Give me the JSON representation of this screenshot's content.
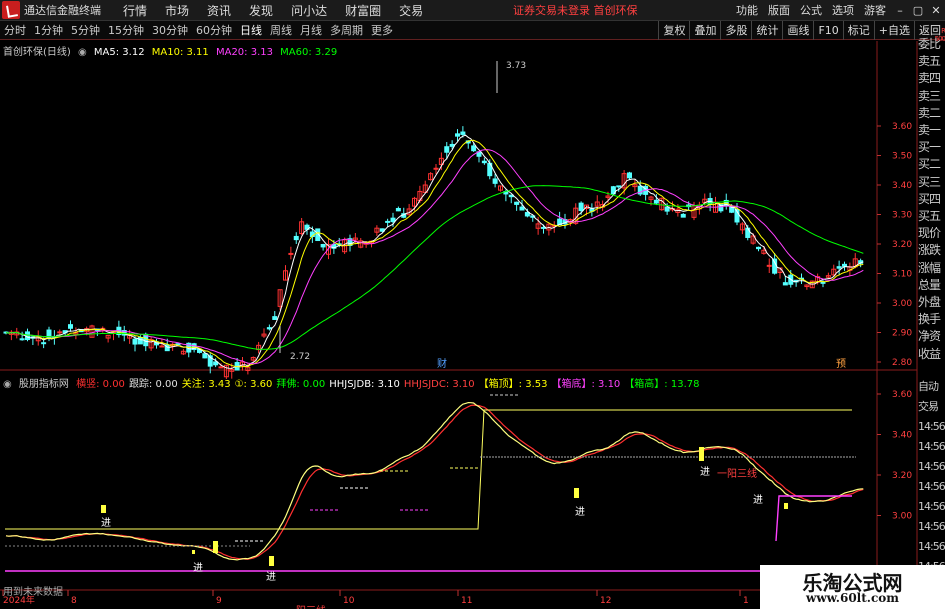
{
  "app": {
    "name": "通达信金融终端",
    "notice": "证券交易未登录  首创环保"
  },
  "menu": [
    "行情",
    "市场",
    "资讯",
    "发现",
    "问小达",
    "财富圈",
    "交易"
  ],
  "menu_right": [
    "功能",
    "版面",
    "公式",
    "选项",
    "游客"
  ],
  "window_controls": [
    "–",
    "▢",
    "✕"
  ],
  "periods": [
    "分时",
    "1分钟",
    "5分钟",
    "15分钟",
    "30分钟",
    "60分钟",
    "日线",
    "周线",
    "月线",
    "多周期",
    "更多"
  ],
  "active_period": "日线",
  "tools": [
    "复权",
    "叠加",
    "多股",
    "统计",
    "画线",
    "F10",
    "标记",
    "+自选",
    "返回"
  ],
  "corner": {
    "r": "R",
    "num": "500"
  },
  "main_legend": {
    "title": "首创环保(日线)",
    "ma5": "MA5: 3.12",
    "ma10": "MA10: 3.11",
    "ma20": "MA20: 3.13",
    "ma60": "MA60: 3.29"
  },
  "main_axis": [
    "3.60",
    "3.50",
    "3.40",
    "3.30",
    "3.20",
    "3.10",
    "3.00",
    "2.90",
    "2.80"
  ],
  "annotations": {
    "high": "3.73",
    "low": "2.72",
    "cai": "财",
    "yu": "预"
  },
  "sub_legend": {
    "title": "股朋指标网",
    "items": [
      {
        "label": "横竖: 0.00",
        "color": "#ff3030"
      },
      {
        "label": "跟踪: 0.00",
        "color": "#e0e0e0"
      },
      {
        "label": "关注: 3.43",
        "color": "#ffff00"
      },
      {
        "label": "①: 3.60",
        "color": "#ffff00"
      },
      {
        "label": "拜佛: 0.00",
        "color": "#00ff00"
      },
      {
        "label": "HHJSJDB: 3.10",
        "color": "#ffffff"
      },
      {
        "label": "HHJSJDC: 3.10",
        "color": "#ff4040"
      },
      {
        "label": "【箱顶】: 3.53",
        "color": "#ffff00"
      },
      {
        "label": "【箱底】: 3.10",
        "color": "#ff40ff"
      },
      {
        "label": "【箱高】: 13.78",
        "color": "#00ff00"
      }
    ]
  },
  "sub_axis": [
    "3.60",
    "3.40",
    "3.20",
    "3.00"
  ],
  "sub_marks": {
    "jin": "进",
    "yiyang": "一阳三线"
  },
  "future_note": "用到未来数据",
  "time_axis": [
    "2024年",
    "8",
    "9",
    "10",
    "11",
    "12",
    "1"
  ],
  "side_panel": [
    "委比",
    "卖五",
    "卖四",
    "卖三",
    "卖二",
    "卖一",
    "买一",
    "买二",
    "买三",
    "买四",
    "买五",
    "现价",
    "涨跌",
    "涨幅",
    "总量",
    "外盘",
    "换手",
    "净资",
    "收益"
  ],
  "side_panel_lower": [
    "自动",
    "交易",
    "14:56",
    "14:56",
    "14:56",
    "14:56",
    "14:56",
    "14:56",
    "14:56",
    "14:56"
  ],
  "watermark": {
    "line1": "乐淘公式网",
    "line2": "www.60lt.com"
  },
  "colors": {
    "up": "#ff3232",
    "down": "#54ffff",
    "ma5": "#ffffff",
    "ma10": "#ffff00",
    "ma20": "#ff40ff",
    "ma60": "#00ff00"
  }
}
